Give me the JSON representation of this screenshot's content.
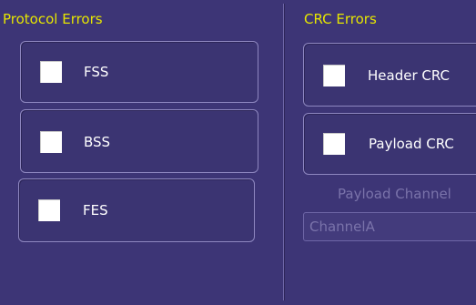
{
  "protocol_errors": {
    "title": "Protocol Errors",
    "items": [
      {
        "label": "FSS",
        "checked": false
      },
      {
        "label": "BSS",
        "checked": false
      },
      {
        "label": "FES",
        "checked": false
      }
    ]
  },
  "crc_errors": {
    "title": "CRC Errors",
    "items": [
      {
        "label": "Header CRC",
        "checked": false
      },
      {
        "label": "Payload CRC",
        "checked": false
      }
    ],
    "payload_channel": {
      "label": "Payload Channel",
      "value": "ChannelA",
      "enabled": false
    }
  },
  "colors": {
    "background": "#3d3576",
    "title": "#e6e600",
    "label": "#ffffff",
    "disabled": "#7a73aa"
  }
}
